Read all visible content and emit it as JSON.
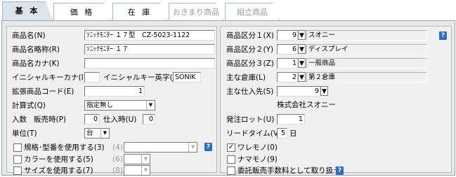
{
  "tabs": {
    "basic": "基 本",
    "price": "価 格",
    "stock": "在 庫",
    "set_item": "おきまり商品",
    "assembly": "組立商品"
  },
  "left": {
    "name_label": "商品名(N)",
    "name_value": "ｿﾆｯｸﾓﾆﾀｰ １７型　CZ-5023-1122",
    "abbr_label": "商品名略称(R)",
    "abbr_value": "ｿﾆｯｸﾓﾆﾀｰ １７",
    "kana_label": "商品名カナ(K)",
    "kana_value": "",
    "initial_kana_label": "イニシャルキーカナ(I)",
    "initial_kana_value": "",
    "initial_eng_label": "イニシャルキー英字(J)",
    "initial_eng_value": "SONIK",
    "ext_code_label": "拡張商品コード(E)",
    "ext_code_value": "1",
    "calc_label": "計算式(Q)",
    "calc_value": "指定無し",
    "qty_label": "入数",
    "sell_label": "販売時(P)",
    "sell_value": "0",
    "buy_label": "仕入時(U)",
    "buy_value": "0",
    "unit_label": "単位(T)",
    "unit_value": "台",
    "spec_label": "規格･型番を使用する(3)",
    "spec_sub": "(4)",
    "color_label": "カラーを使用する(5)",
    "color_sub": "(6)",
    "size_label": "サイズを使用する(7)",
    "size_sub": "(8)",
    "help": "?"
  },
  "right": {
    "cat1_label": "商品区分１(X)",
    "cat1_code": "9",
    "cat1_name": "スオニー",
    "cat2_label": "商品区分２(Y)",
    "cat2_code": "6",
    "cat2_name": "ディスプレイ",
    "cat3_label": "商品区分３(Z)",
    "cat3_code": "1",
    "cat3_name": "一般商品",
    "warehouse_label": "主な倉庫(L)",
    "warehouse_code": "2",
    "warehouse_name": "第２倉庫",
    "supplier_label": "主な仕入先(S)",
    "supplier_code": "9",
    "supplier_name": "株式会社スオニー",
    "lot_label": "発注ロット(U)",
    "lot_value": "1",
    "lead_label": "リードタイム(V)",
    "lead_value": "5",
    "lead_unit": "日",
    "fragile_label": "ワレモノ(0)",
    "raw_label": "ナマモノ(9)",
    "consign_label": "委託販売手数料として取り扱う",
    "help": "?"
  }
}
